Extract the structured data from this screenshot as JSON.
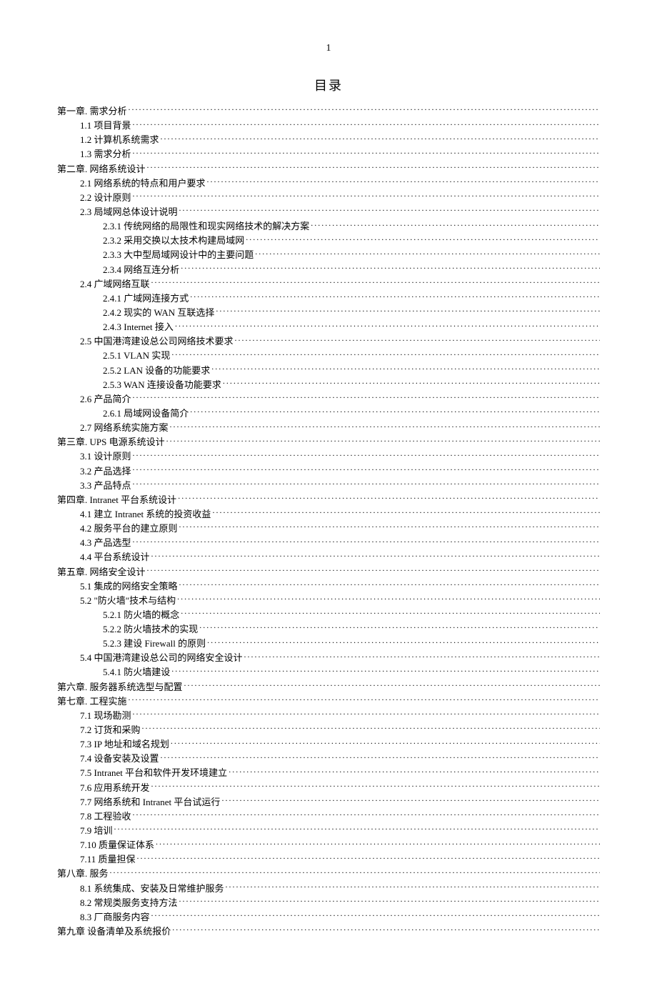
{
  "page_number": "1",
  "title": "目录",
  "toc": [
    {
      "level": 0,
      "text": "第一章. 需求分析"
    },
    {
      "level": 1,
      "text": "1.1  项目背景"
    },
    {
      "level": 1,
      "text": "1.2  计算机系统需求"
    },
    {
      "level": 1,
      "text": "1.3  需求分析"
    },
    {
      "level": 0,
      "text": "第二章. 网络系统设计"
    },
    {
      "level": 1,
      "text": "2.1  网络系统的特点和用户要求"
    },
    {
      "level": 1,
      "text": "2.2  设计原则"
    },
    {
      "level": 1,
      "text": "2.3  局域网总体设计说明"
    },
    {
      "level": 2,
      "text": "2.3.1  传统网络的局限性和现实网络技术的解决方案"
    },
    {
      "level": 2,
      "text": "2.3.2  采用交换以太技术构建局域网"
    },
    {
      "level": 2,
      "text": "2.3.3  大中型局域网设计中的主要问题"
    },
    {
      "level": 2,
      "text": "2.3.4  网络互连分析"
    },
    {
      "level": 1,
      "text": "2.4  广域网络互联"
    },
    {
      "level": 2,
      "text": "2.4.1  广域网连接方式"
    },
    {
      "level": 2,
      "text": "2.4.2  现实的 WAN 互联选择"
    },
    {
      "level": 2,
      "text": "2.4.3  Internet 接入"
    },
    {
      "level": 1,
      "text": "2.5  中国港湾建设总公司网络技术要求"
    },
    {
      "level": 2,
      "text": "2.5.1  VLAN 实现"
    },
    {
      "level": 2,
      "text": "2.5.2  LAN 设备的功能要求"
    },
    {
      "level": 2,
      "text": "2.5.3  WAN 连接设备功能要求"
    },
    {
      "level": 1,
      "text": "2.6  产品简介"
    },
    {
      "level": 2,
      "text": "2.6.1  局域网设备简介"
    },
    {
      "level": 1,
      "text": "2.7  网络系统实施方案"
    },
    {
      "level": 0,
      "text": "第三章. UPS 电源系统设计"
    },
    {
      "level": 1,
      "text": "3.1  设计原则"
    },
    {
      "level": 1,
      "text": "3.2  产品选择"
    },
    {
      "level": 1,
      "text": "3.3  产品特点"
    },
    {
      "level": 0,
      "text": "第四章. Intranet 平台系统设计"
    },
    {
      "level": 1,
      "text": "4.1 建立 Intranet 系统的投资收益"
    },
    {
      "level": 1,
      "text": "4.2 服务平台的建立原则"
    },
    {
      "level": 1,
      "text": "4.3  产品选型"
    },
    {
      "level": 1,
      "text": "4.4  平台系统设计"
    },
    {
      "level": 0,
      "text": "第五章. 网络安全设计"
    },
    {
      "level": 1,
      "text": "5.1  集成的网络安全策略"
    },
    {
      "level": 1,
      "text": "5.2  \"防火墙\"技术与结构"
    },
    {
      "level": 2,
      "text": "5.2.1  防火墙的概念"
    },
    {
      "level": 2,
      "text": "5.2.2  防火墙技术的实现"
    },
    {
      "level": 2,
      "text": "5.2.3  建设 Firewall 的原则"
    },
    {
      "level": 1,
      "text": "5.4  中国港湾建设总公司的网络安全设计"
    },
    {
      "level": 2,
      "text": "5.4.1  防火墙建设"
    },
    {
      "level": 0,
      "text": "第六章. 服务器系统选型与配置"
    },
    {
      "level": 0,
      "text": "第七章. 工程实施"
    },
    {
      "level": 1,
      "text": "7.1  现场勘测"
    },
    {
      "level": 1,
      "text": "7.2  订货和采购"
    },
    {
      "level": 1,
      "text": "7.3  IP 地址和域名规划"
    },
    {
      "level": 1,
      "text": "7.4  设备安装及设置"
    },
    {
      "level": 1,
      "text": "7.5  Intranet 平台和软件开发环境建立"
    },
    {
      "level": 1,
      "text": "7.6  应用系统开发"
    },
    {
      "level": 1,
      "text": "7.7  网络系统和 Intranet 平台试运行"
    },
    {
      "level": 1,
      "text": "7.8  工程验收"
    },
    {
      "level": 1,
      "text": "7.9  培训"
    },
    {
      "level": 1,
      "text": "7.10  质量保证体系"
    },
    {
      "level": 1,
      "text": "7.11  质量担保"
    },
    {
      "level": 0,
      "text": "第八章. 服务"
    },
    {
      "level": 1,
      "text": "8.1  系统集成、安装及日常维护服务"
    },
    {
      "level": 1,
      "text": "8.2  常规类服务支持方法"
    },
    {
      "level": 1,
      "text": "8.3  厂商服务内容"
    },
    {
      "level": 0,
      "text": "第九章 设备清单及系统报价"
    }
  ]
}
